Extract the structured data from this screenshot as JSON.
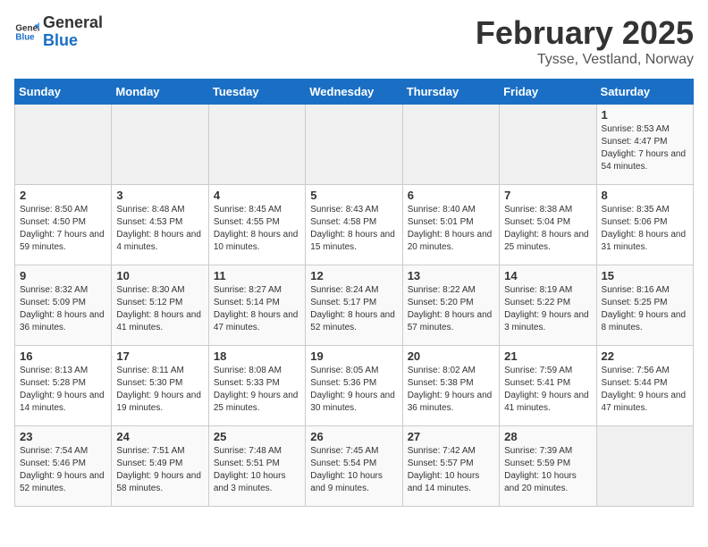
{
  "header": {
    "logo_general": "General",
    "logo_blue": "Blue",
    "title": "February 2025",
    "subtitle": "Tysse, Vestland, Norway"
  },
  "days_of_week": [
    "Sunday",
    "Monday",
    "Tuesday",
    "Wednesday",
    "Thursday",
    "Friday",
    "Saturday"
  ],
  "weeks": [
    [
      {
        "day": "",
        "text": ""
      },
      {
        "day": "",
        "text": ""
      },
      {
        "day": "",
        "text": ""
      },
      {
        "day": "",
        "text": ""
      },
      {
        "day": "",
        "text": ""
      },
      {
        "day": "",
        "text": ""
      },
      {
        "day": "1",
        "text": "Sunrise: 8:53 AM\nSunset: 4:47 PM\nDaylight: 7 hours and 54 minutes."
      }
    ],
    [
      {
        "day": "2",
        "text": "Sunrise: 8:50 AM\nSunset: 4:50 PM\nDaylight: 7 hours and 59 minutes."
      },
      {
        "day": "3",
        "text": "Sunrise: 8:48 AM\nSunset: 4:53 PM\nDaylight: 8 hours and 4 minutes."
      },
      {
        "day": "4",
        "text": "Sunrise: 8:45 AM\nSunset: 4:55 PM\nDaylight: 8 hours and 10 minutes."
      },
      {
        "day": "5",
        "text": "Sunrise: 8:43 AM\nSunset: 4:58 PM\nDaylight: 8 hours and 15 minutes."
      },
      {
        "day": "6",
        "text": "Sunrise: 8:40 AM\nSunset: 5:01 PM\nDaylight: 8 hours and 20 minutes."
      },
      {
        "day": "7",
        "text": "Sunrise: 8:38 AM\nSunset: 5:04 PM\nDaylight: 8 hours and 25 minutes."
      },
      {
        "day": "8",
        "text": "Sunrise: 8:35 AM\nSunset: 5:06 PM\nDaylight: 8 hours and 31 minutes."
      }
    ],
    [
      {
        "day": "9",
        "text": "Sunrise: 8:32 AM\nSunset: 5:09 PM\nDaylight: 8 hours and 36 minutes."
      },
      {
        "day": "10",
        "text": "Sunrise: 8:30 AM\nSunset: 5:12 PM\nDaylight: 8 hours and 41 minutes."
      },
      {
        "day": "11",
        "text": "Sunrise: 8:27 AM\nSunset: 5:14 PM\nDaylight: 8 hours and 47 minutes."
      },
      {
        "day": "12",
        "text": "Sunrise: 8:24 AM\nSunset: 5:17 PM\nDaylight: 8 hours and 52 minutes."
      },
      {
        "day": "13",
        "text": "Sunrise: 8:22 AM\nSunset: 5:20 PM\nDaylight: 8 hours and 57 minutes."
      },
      {
        "day": "14",
        "text": "Sunrise: 8:19 AM\nSunset: 5:22 PM\nDaylight: 9 hours and 3 minutes."
      },
      {
        "day": "15",
        "text": "Sunrise: 8:16 AM\nSunset: 5:25 PM\nDaylight: 9 hours and 8 minutes."
      }
    ],
    [
      {
        "day": "16",
        "text": "Sunrise: 8:13 AM\nSunset: 5:28 PM\nDaylight: 9 hours and 14 minutes."
      },
      {
        "day": "17",
        "text": "Sunrise: 8:11 AM\nSunset: 5:30 PM\nDaylight: 9 hours and 19 minutes."
      },
      {
        "day": "18",
        "text": "Sunrise: 8:08 AM\nSunset: 5:33 PM\nDaylight: 9 hours and 25 minutes."
      },
      {
        "day": "19",
        "text": "Sunrise: 8:05 AM\nSunset: 5:36 PM\nDaylight: 9 hours and 30 minutes."
      },
      {
        "day": "20",
        "text": "Sunrise: 8:02 AM\nSunset: 5:38 PM\nDaylight: 9 hours and 36 minutes."
      },
      {
        "day": "21",
        "text": "Sunrise: 7:59 AM\nSunset: 5:41 PM\nDaylight: 9 hours and 41 minutes."
      },
      {
        "day": "22",
        "text": "Sunrise: 7:56 AM\nSunset: 5:44 PM\nDaylight: 9 hours and 47 minutes."
      }
    ],
    [
      {
        "day": "23",
        "text": "Sunrise: 7:54 AM\nSunset: 5:46 PM\nDaylight: 9 hours and 52 minutes."
      },
      {
        "day": "24",
        "text": "Sunrise: 7:51 AM\nSunset: 5:49 PM\nDaylight: 9 hours and 58 minutes."
      },
      {
        "day": "25",
        "text": "Sunrise: 7:48 AM\nSunset: 5:51 PM\nDaylight: 10 hours and 3 minutes."
      },
      {
        "day": "26",
        "text": "Sunrise: 7:45 AM\nSunset: 5:54 PM\nDaylight: 10 hours and 9 minutes."
      },
      {
        "day": "27",
        "text": "Sunrise: 7:42 AM\nSunset: 5:57 PM\nDaylight: 10 hours and 14 minutes."
      },
      {
        "day": "28",
        "text": "Sunrise: 7:39 AM\nSunset: 5:59 PM\nDaylight: 10 hours and 20 minutes."
      },
      {
        "day": "",
        "text": ""
      }
    ]
  ]
}
